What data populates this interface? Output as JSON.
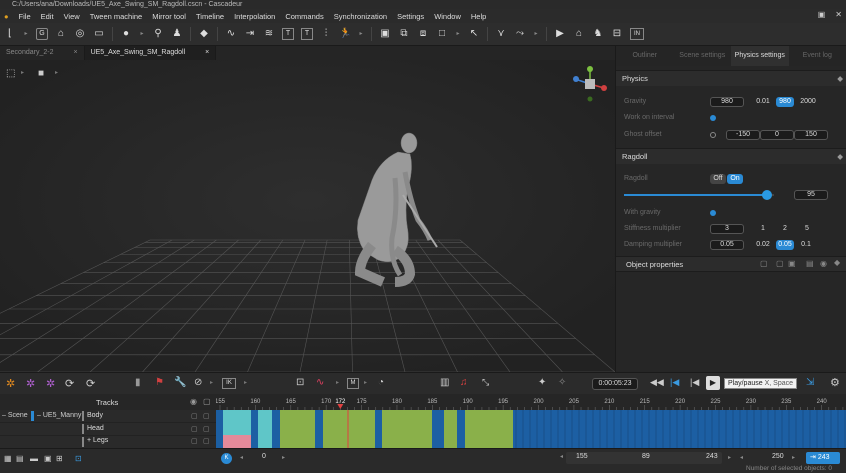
{
  "window": {
    "title": "C:/Users/ana/Downloads/UE5_Axe_Swing_SM_Ragdoll.cscn - Cascadeur"
  },
  "menu": [
    "File",
    "Edit",
    "View",
    "Tween machine",
    "Mirror tool",
    "Timeline",
    "Interpolation",
    "Commands",
    "Synchronization",
    "Settings",
    "Window",
    "Help"
  ],
  "toolbar": {
    "key_letter": "G",
    "t_box": "T",
    "t_box2": "T",
    "in_box": "IN"
  },
  "scene_tabs": [
    {
      "label": "Secondary_2-2",
      "close": "×"
    },
    {
      "label": "UE5_Axe_Swing_SM_Ragdoll",
      "close": "×"
    }
  ],
  "right_tabs": [
    "Outliner",
    "Scene settings",
    "Physics settings",
    "Event log"
  ],
  "physics": {
    "section": "Physics",
    "gravity_label": "Gravity",
    "gravity_value": "980",
    "gravity_options": [
      "0.01",
      "980",
      "2000"
    ],
    "work_on_interval": "Work on interval",
    "ghost_offset_label": "Ghost offset",
    "ghost_offset": [
      "-150",
      "0",
      "150"
    ]
  },
  "ragdoll": {
    "section": "Ragdoll",
    "ragdoll_label": "Ragdoll",
    "off": "Off",
    "on": "On",
    "slider_value": 0.95,
    "slider_number": "95",
    "with_gravity": "With gravity",
    "stiffness_label": "Stiffness multiplier",
    "stiffness_value": "3",
    "stiffness_options": [
      "1",
      "2",
      "5"
    ],
    "damping_label": "Damping multiplier",
    "damping_value": "0.05",
    "damping_options": [
      "0.02",
      "0.05",
      "0.1"
    ]
  },
  "object_properties": "Object properties",
  "timeline": {
    "timecode": "0:00:05:23",
    "tooltip_label": "Play/pause",
    "tooltip_keys": "X, Space",
    "ik_label": "IK",
    "m_label": "M",
    "current_frame_value": 172
  },
  "tracks": {
    "header": "Tracks",
    "scene": "Scene",
    "character": "UE5_Manny",
    "rows": [
      "Body",
      "Head",
      "Legs"
    ],
    "plus": "+"
  },
  "ruler": {
    "start": 155,
    "step": 5,
    "end": 240,
    "labels": [
      "155",
      "160",
      "165",
      "170",
      "172",
      "175",
      "180",
      "185",
      "190",
      "195",
      "200",
      "205",
      "210",
      "215",
      "220",
      "225",
      "230",
      "235",
      "240"
    ]
  },
  "bottom": {
    "k_label": "K",
    "frame_zero": "0",
    "range_start": "155",
    "range_mid": "89",
    "range_end": "243",
    "total": "250",
    "total_frames": "243",
    "status": "Number of selected objects: 0"
  },
  "colors": {
    "accent": "#2a8ad4",
    "track_green": "#8ab04a",
    "track_blue": "#1c5fa3",
    "track_cyan": "#5fc6c8",
    "track_pink": "#e48a9a",
    "playhead": "#e04040"
  }
}
